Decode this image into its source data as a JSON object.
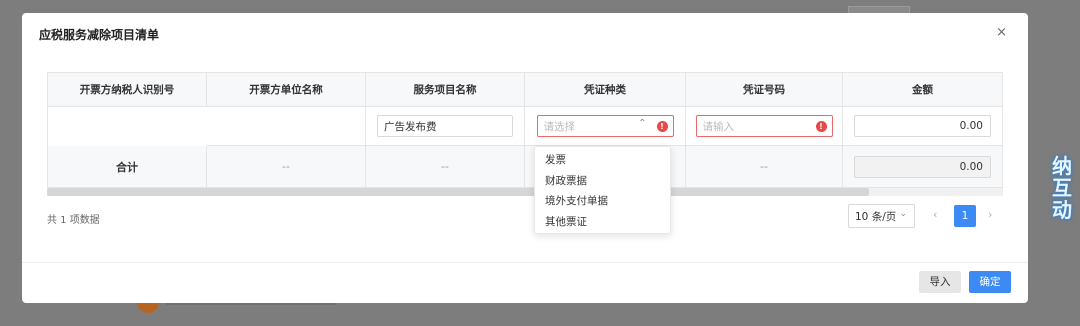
{
  "dialog": {
    "title": "应税服务减除项目清单",
    "close_label": "×"
  },
  "table": {
    "headers": [
      "开票方纳税人识别号",
      "开票方单位名称",
      "服务项目名称",
      "凭证种类",
      "凭证号码",
      "金额"
    ],
    "input_row": {
      "service_name": "广告发布费",
      "voucher_type_placeholder": "请选择",
      "voucher_number_placeholder": "请输入",
      "amount": "0.00"
    },
    "total_row": {
      "label": "合计",
      "seller_name": "--",
      "service_name": "--",
      "voucher_number": "--",
      "amount": "0.00"
    }
  },
  "dropdown": {
    "options": [
      "发票",
      "财政票据",
      "境外支付单据",
      "其他票证"
    ]
  },
  "pagination": {
    "summary": "共 1 项数据",
    "page_size": "10 条/页",
    "current_page": "1",
    "prev": "‹",
    "next": "›"
  },
  "footer": {
    "import_label": "导入",
    "confirm_label": "确定"
  },
  "background": {
    "badge_chars": [
      "纳",
      "互",
      "动"
    ]
  },
  "colors": {
    "primary": "#3d8af5",
    "error": "#e84848",
    "overlay": "#7d7d7d"
  }
}
